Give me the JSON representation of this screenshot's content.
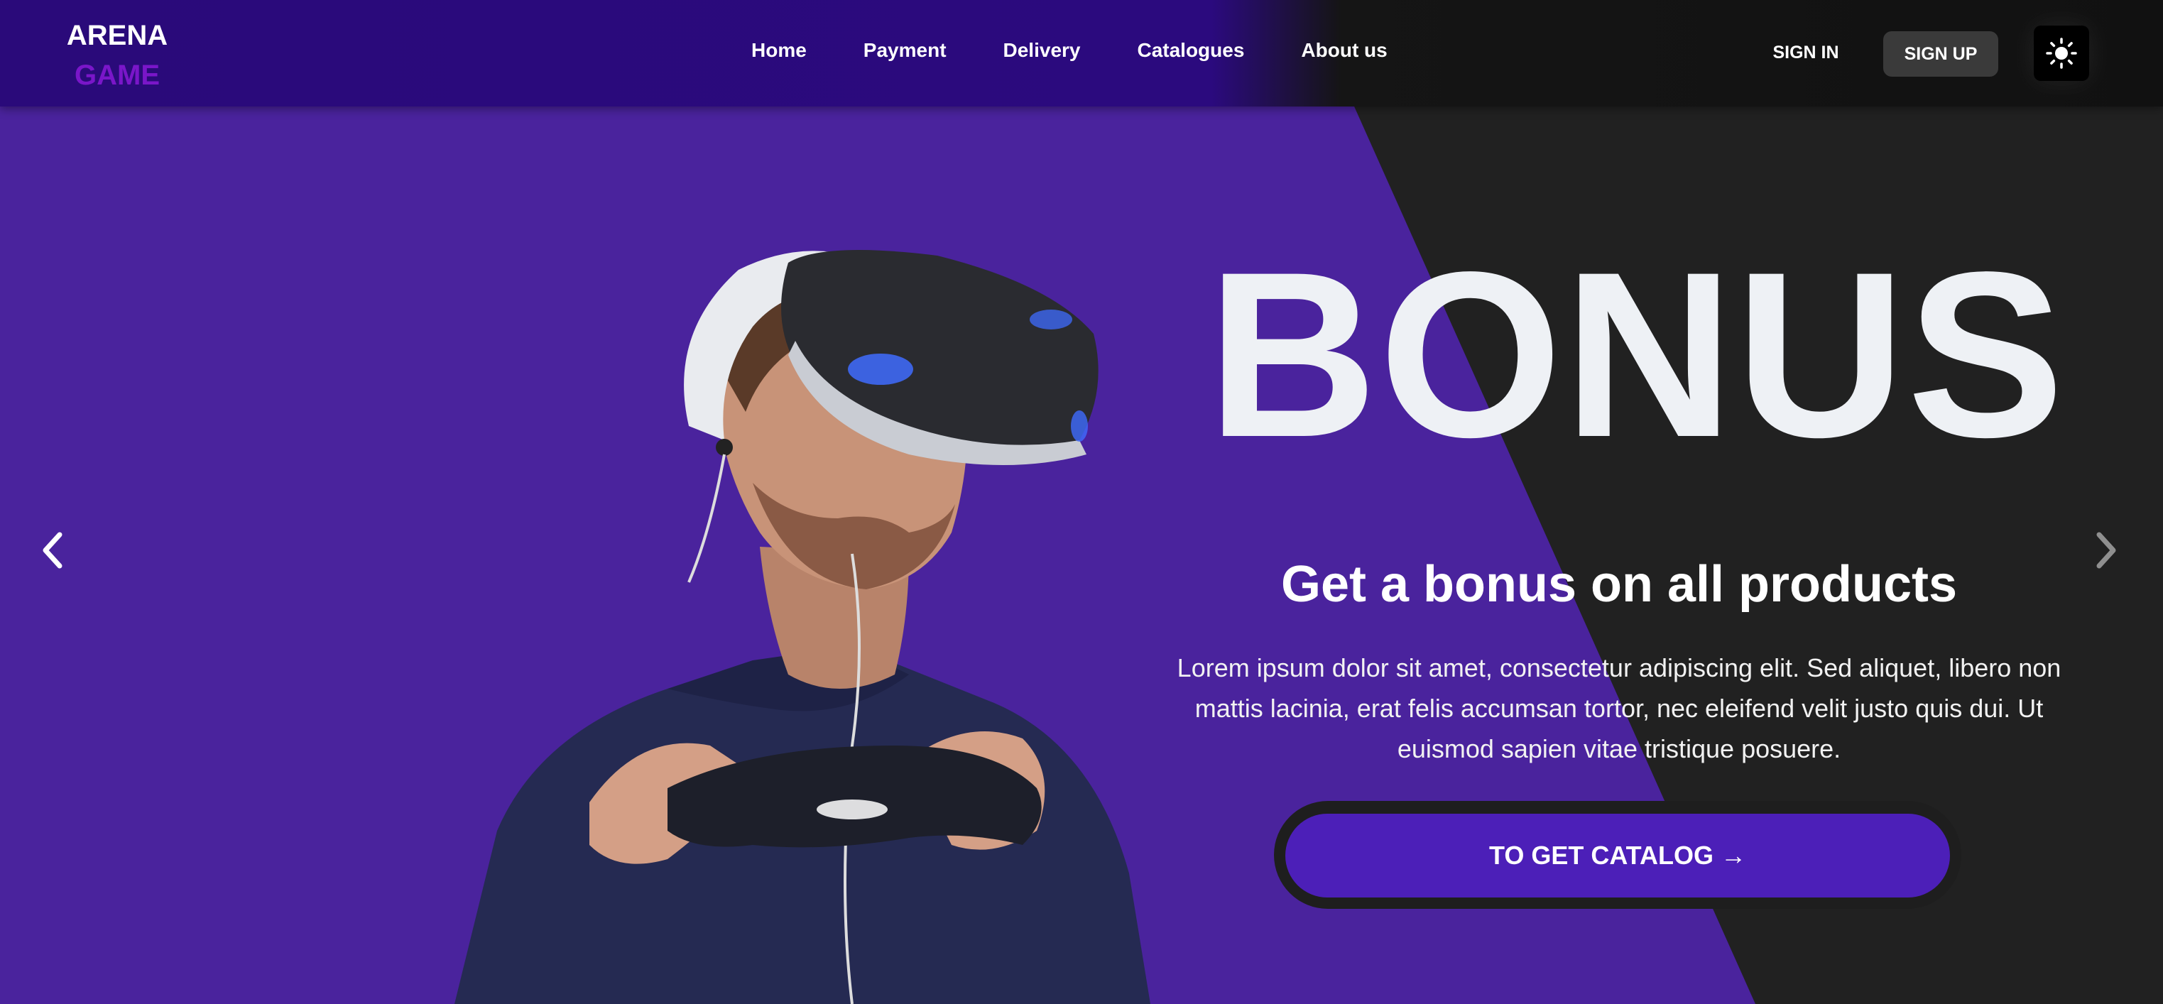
{
  "header": {
    "logo": {
      "line1": "ARENA",
      "line2": "GAME"
    },
    "nav": [
      {
        "label": "Home"
      },
      {
        "label": "Payment"
      },
      {
        "label": "Delivery"
      },
      {
        "label": "Catalogues"
      },
      {
        "label": "About us"
      }
    ],
    "sign_in": "SIGN IN",
    "sign_up": "SIGN UP",
    "theme_toggle_icon": "sun-icon"
  },
  "hero": {
    "title": "BONUS",
    "subtitle": "Get a bonus on all products",
    "description": "Lorem ipsum dolor sit amet, consectetur adipiscing elit. Sed aliquet, libero non mattis lacinia, erat felis accumsan tortor, nec eleifend velit justo quis dui. Ut euismod sapien vitae tristique posuere.",
    "cta_label": "TO GET CATALOG →",
    "image_icon": "vr-gamer-illustration",
    "prev_icon": "chevron-left-icon",
    "next_icon": "chevron-right-icon"
  },
  "colors": {
    "primary_purple": "#4c1fb8",
    "hero_purple": "#4a239d",
    "dark_bg": "#212121",
    "header_purple": "#2b0a7e",
    "logo_accent": "#7a16c9",
    "text_white": "#ffffff"
  }
}
